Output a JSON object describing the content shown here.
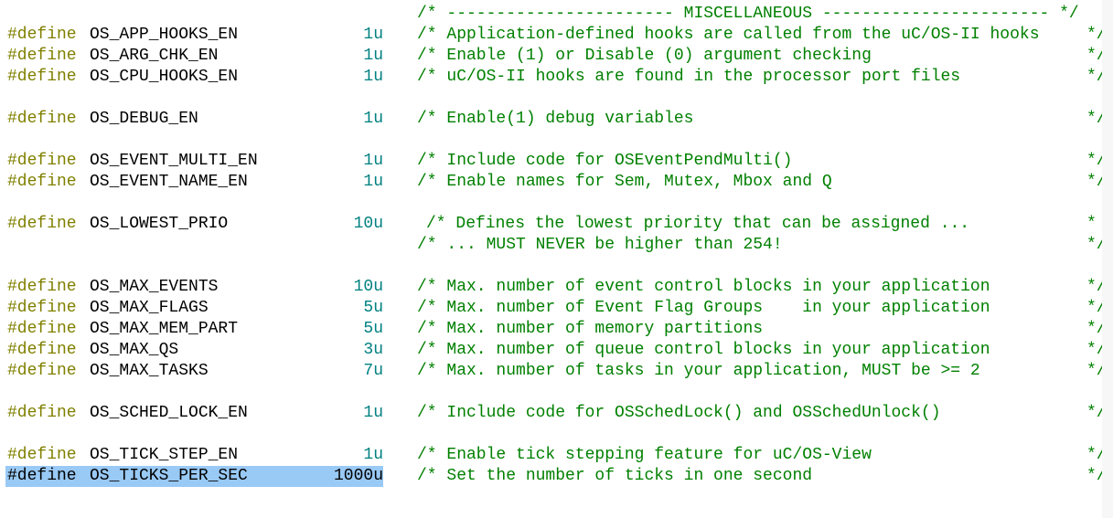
{
  "header_comment": "/* ----------------------- MISCELLANEOUS ----------------------- */",
  "lines": [
    {
      "kw": "#define",
      "name": "OS_APP_HOOKS_EN",
      "value": "1u",
      "comment": "/* Application-defined hooks are called from the uC/OS-II hooks",
      "end": "*/"
    },
    {
      "kw": "#define",
      "name": "OS_ARG_CHK_EN",
      "value": "1u",
      "comment": "/* Enable (1) or Disable (0) argument checking",
      "end": "*/"
    },
    {
      "kw": "#define",
      "name": "OS_CPU_HOOKS_EN",
      "value": "1u",
      "comment": "/* uC/OS-II hooks are found in the processor port files",
      "end": "*/"
    },
    {
      "kw": "#define",
      "name": "OS_DEBUG_EN",
      "value": "1u",
      "comment": "/* Enable(1) debug variables",
      "end": "*/"
    },
    {
      "kw": "#define",
      "name": "OS_EVENT_MULTI_EN",
      "value": "1u",
      "comment": "/* Include code for OSEventPendMulti()",
      "end": "*/"
    },
    {
      "kw": "#define",
      "name": "OS_EVENT_NAME_EN",
      "value": "1u",
      "comment": "/* Enable names for Sem, Mutex, Mbox and Q",
      "end": "*/"
    },
    {
      "kw": "#define",
      "name": "OS_LOWEST_PRIO",
      "value": "10u",
      "comment": "/* Defines the lowest priority that can be assigned ...",
      "end": "*"
    },
    {
      "kw": "",
      "name": "",
      "value": "",
      "comment": "/* ... MUST NEVER be higher than 254!",
      "end": "*/"
    },
    {
      "kw": "#define",
      "name": "OS_MAX_EVENTS",
      "value": "10u",
      "comment": "/* Max. number of event control blocks in your application",
      "end": "*/"
    },
    {
      "kw": "#define",
      "name": "OS_MAX_FLAGS",
      "value": "5u",
      "comment": "/* Max. number of Event Flag Groups    in your application",
      "end": "*/"
    },
    {
      "kw": "#define",
      "name": "OS_MAX_MEM_PART",
      "value": "5u",
      "comment": "/* Max. number of memory partitions",
      "end": "*/"
    },
    {
      "kw": "#define",
      "name": "OS_MAX_QS",
      "value": "3u",
      "comment": "/* Max. number of queue control blocks in your application",
      "end": "*/"
    },
    {
      "kw": "#define",
      "name": "OS_MAX_TASKS",
      "value": "7u",
      "comment": "/* Max. number of tasks in your application, MUST be >= 2",
      "end": "*/"
    },
    {
      "kw": "#define",
      "name": "OS_SCHED_LOCK_EN",
      "value": "1u",
      "comment": "/* Include code for OSSchedLock() and OSSchedUnlock()",
      "end": "*/"
    },
    {
      "kw": "#define",
      "name": "OS_TICK_STEP_EN",
      "value": "1u",
      "comment": "/* Enable tick stepping feature for uC/OS-View",
      "end": "*/"
    },
    {
      "kw": "#define",
      "name": "OS_TICKS_PER_SEC",
      "value": "1000u",
      "comment": "/* Set the number of ticks in one second",
      "end": "*/"
    }
  ],
  "selected_line": 15
}
